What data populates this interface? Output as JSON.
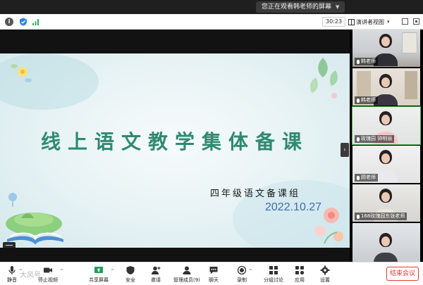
{
  "banner": {
    "viewing_text": "您正在观看韩老师的屏幕"
  },
  "topbar": {
    "timer": "30:23",
    "view_label": "演讲者视图"
  },
  "slide": {
    "title": "线上语文教学集体备课",
    "group": "四年级语文备课组",
    "date": "2022.10.27"
  },
  "gallery": {
    "tiles": [
      {
        "name": "韩老师"
      },
      {
        "name": "韩老师"
      },
      {
        "name": "玫瑰园 钟明丽"
      },
      {
        "name": "顾老师"
      },
      {
        "name": "168玫瑰园东张老师"
      },
      {
        "name": ""
      }
    ]
  },
  "toolbar": {
    "mute": "静音",
    "stop_video": "停止视频",
    "share_screen": "共享屏幕",
    "security": "安全",
    "invite": "邀请",
    "participants": "管理成员(9)",
    "chat": "聊天",
    "record": "录制",
    "breakout": "分组讨论",
    "apps": "应用",
    "settings": "设置",
    "end_meeting": "结束会议",
    "watermark": "大风号"
  },
  "colors": {
    "end_red": "#e53935",
    "title_green": "#2f8a72",
    "date_blue": "#3e6bb3"
  }
}
